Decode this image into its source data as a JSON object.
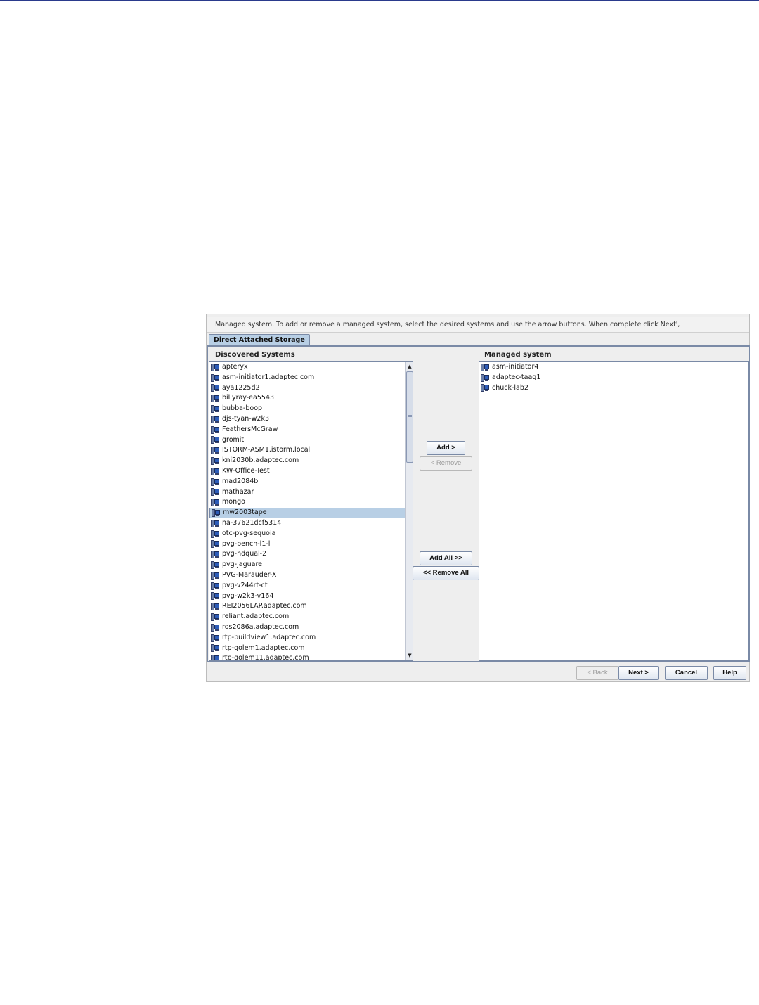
{
  "instruction": "Managed system.  To add or remove a managed system, select the desired systems and use the arrow buttons.  When complete click Next',",
  "tab_label": "Direct Attached Storage",
  "discovered": {
    "title": "Discovered Systems",
    "items": [
      "apteryx",
      "asm-initiator1.adaptec.com",
      "aya1225d2",
      "billyray-ea5543",
      "bubba-boop",
      "djs-tyan-w2k3",
      "FeathersMcGraw",
      "gromit",
      "ISTORM-ASM1.istorm.local",
      "kni2030b.adaptec.com",
      "KW-Office-Test",
      "mad2084b",
      "mathazar",
      "mongo",
      "mw2003tape",
      "na-37621dcf5314",
      "otc-pvg-sequoia",
      "pvg-bench-l1-l",
      "pvg-hdqual-2",
      "pvg-jaguare",
      "PVG-Marauder-X",
      "pvg-v244rt-ct",
      "pvg-w2k3-v164",
      "REI2056LAP.adaptec.com",
      "reliant.adaptec.com",
      "ros2086a.adaptec.com",
      "rtp-buildview1.adaptec.com",
      "rtp-golem1.adaptec.com",
      "rtp-golem11.adaptec.com"
    ],
    "selected": "mw2003tape"
  },
  "managed": {
    "title": "Managed system",
    "items": [
      "asm-initiator4",
      "adaptec-taag1",
      "chuck-lab2"
    ]
  },
  "buttons": {
    "add": "Add >",
    "remove": "< Remove",
    "add_all": "Add All >>",
    "remove_all": "<< Remove All",
    "back": "< Back",
    "next": "Next >",
    "cancel": "Cancel",
    "help": "Help"
  },
  "colors": {
    "selection": "#b8cfe5",
    "border": "#7a8aa6",
    "page_rule": "#2a3a8c"
  }
}
